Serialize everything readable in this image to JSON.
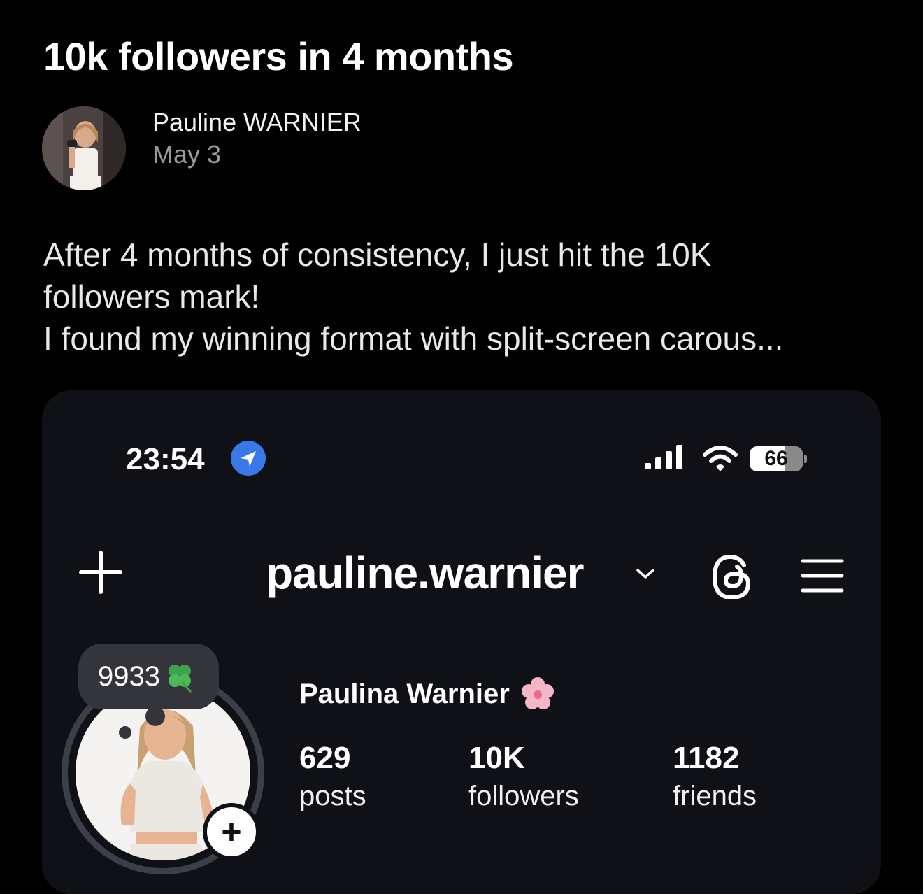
{
  "post": {
    "title": "10k followers in 4 months",
    "author": "Pauline WARNIER",
    "date": "May 3",
    "body_lines": [
      "After 4 months of consistency, I just hit the 10K",
      "followers mark!",
      "I found my winning format with split-screen carous..."
    ]
  },
  "screenshot": {
    "status_bar": {
      "time": "23:54",
      "battery_percent": 66,
      "battery_label": "66",
      "icons": [
        "location-arrow-icon",
        "signal-icon",
        "wifi-icon",
        "battery-icon"
      ]
    },
    "header": {
      "username": "pauline.warnier",
      "icons": [
        "plus-icon",
        "chevron-down-icon",
        "threads-icon",
        "menu-icon"
      ]
    },
    "profile": {
      "note": "9933",
      "note_icon": "four-leaf-clover-icon",
      "display_name": "Paulina Warnier",
      "name_icon": "cherry-blossom-icon",
      "stats": [
        {
          "value": "629",
          "label": "posts"
        },
        {
          "value": "10K",
          "label": "followers"
        },
        {
          "value": "1182",
          "label": "friends"
        }
      ]
    }
  },
  "colors": {
    "background": "#000000",
    "card": "#0f1117",
    "location_blue": "#3a78e8",
    "note_bubble": "#33353b"
  }
}
